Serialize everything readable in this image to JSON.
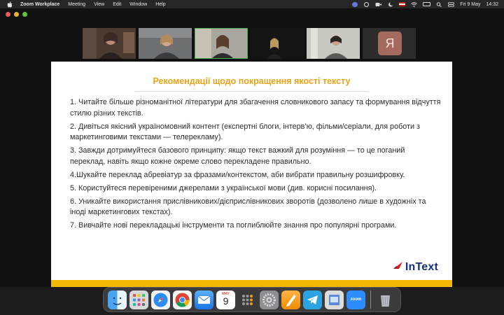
{
  "menubar": {
    "app_name": "Zoom Workplace",
    "menus": [
      "Meeting",
      "View",
      "Edit",
      "Window",
      "Help"
    ],
    "date": "Fri 9 May",
    "time": "14:32"
  },
  "gallery": {
    "avatar_letter": "Я"
  },
  "slide": {
    "title": "Рекомендації щодо покращення якості тексту",
    "items": [
      "1. Читайте більше різноманітної літератури для збагачення словникового запасу та формування відчуття стилю різних текстів.",
      "2. Дивіться якісний україномовний контент (експертні блоги, інтерв’ю, фільми/серіали, для роботи з маркетинговими текстами — телерекламу).",
      "3. Завжди дотримуйтеся базового принципу: якщо текст важкий для розуміння — то це поганий переклад, навіть якщо кожне окреме слово перекладене правильно.",
      "4.Шукайте переклад абревіатур за фразами/контекстом, аби вибрати правильну розшифровку.",
      "5. Користуйтеся перевіреними джерелами з української мови (див. корисні посилання).",
      "6. Уникайте використання прислівникових/дієприслівникових зворотів (дозволено лише в художніх та іноді маркетингових текстах).",
      "7. Вивчайте нові перекладацькі інструменти та поглиблюйте знання про популярні програми."
    ],
    "logo_text": "InText",
    "colors": {
      "title": "#e8a317",
      "bar": "#f2b705",
      "logo": "#14307a",
      "logo_mark": "#d62828"
    }
  },
  "dock": {
    "apps": [
      "finder-icon",
      "launchpad-icon",
      "safari-icon",
      "chrome-icon",
      "mail-icon",
      "calendar-icon",
      "calculator-icon",
      "system-settings-icon",
      "pages-icon",
      "telegram-icon",
      "preview-icon",
      "zoom-icon",
      "trash-icon"
    ],
    "calendar_month": "MAY",
    "calendar_day": "9",
    "zoom_label": "zoom"
  }
}
